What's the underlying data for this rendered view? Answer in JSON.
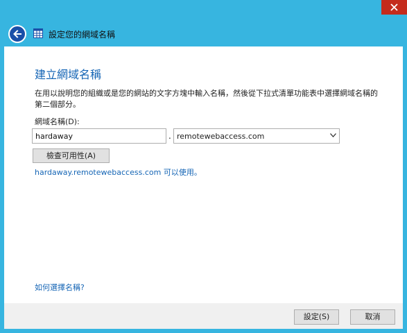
{
  "header": {
    "title": "設定您的網域名稱"
  },
  "main": {
    "page_title": "建立網域名稱",
    "description": "在用以說明您的組織或是您的網站的文字方塊中輸入名稱，然後從下拉式清單功能表中選擇網域名稱的第二個部分。",
    "domain_label": "網域名稱(D):",
    "name_value": "hardaway",
    "separator": ".",
    "domain_selected": "remotewebaccess.com",
    "check_button": "檢查可用性(A)",
    "result_text": "hardaway.remotewebaccess.com 可以使用。",
    "help_link": "如何選擇名稱?"
  },
  "footer": {
    "ok_label": "設定(S)",
    "cancel_label": "取消"
  },
  "icons": {
    "back": "back-arrow-icon",
    "app": "grid-icon",
    "close": "close-icon",
    "dropdown": "chevron-down-icon"
  },
  "colors": {
    "frame": "#37b5e0",
    "close": "#c42b1c",
    "link": "#1565b5",
    "back_button": "#1a4fa8"
  }
}
